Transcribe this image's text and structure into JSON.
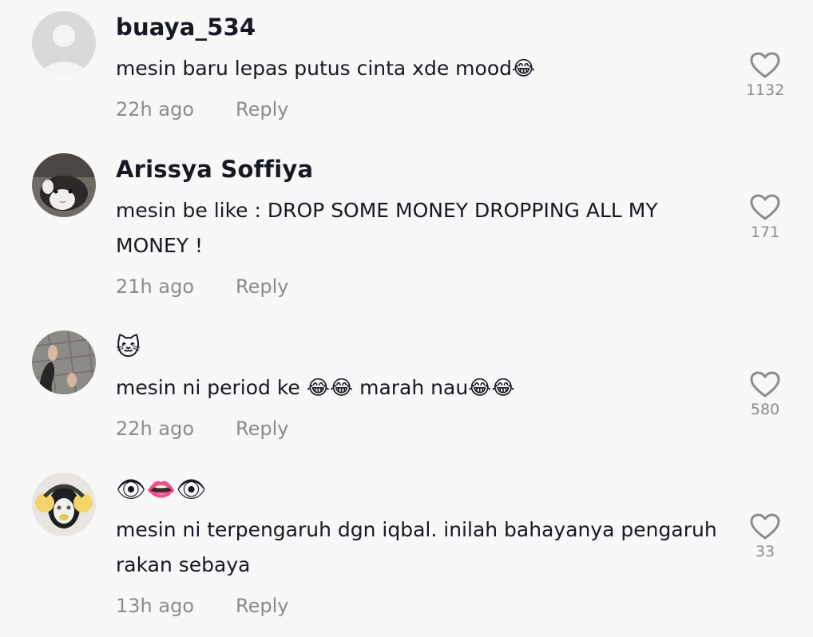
{
  "comments": [
    {
      "username": "buaya_534",
      "text": "mesin baru lepas putus cinta xde mood😂",
      "time": "22h ago",
      "reply": "Reply",
      "likes": "1132",
      "avatar_icon": "default-avatar-icon"
    },
    {
      "username": "Arissya Soffiya",
      "text": "mesin be like : DROP SOME MONEY DROPPING ALL MY MONEY !",
      "time": "21h ago",
      "reply": "Reply",
      "likes": "171",
      "avatar_icon": "cat-photo-avatar"
    },
    {
      "username_emoji": "🐱",
      "text": "mesin ni period ke 😂😂 marah nau😂😂",
      "time": "22h ago",
      "reply": "Reply",
      "likes": "580",
      "avatar_icon": "feet-photo-avatar"
    },
    {
      "username_emoji": "👁👄👁",
      "text": "mesin ni terpengaruh dgn iqbal. inilah bahayanya pengaruh rakan sebaya",
      "time": "13h ago",
      "reply": "Reply",
      "likes": "33",
      "avatar_icon": "masked-person-avatar"
    }
  ],
  "colors": {
    "background": "#f8f8f8",
    "text": "#161823",
    "secondary": "#8a8b91"
  }
}
